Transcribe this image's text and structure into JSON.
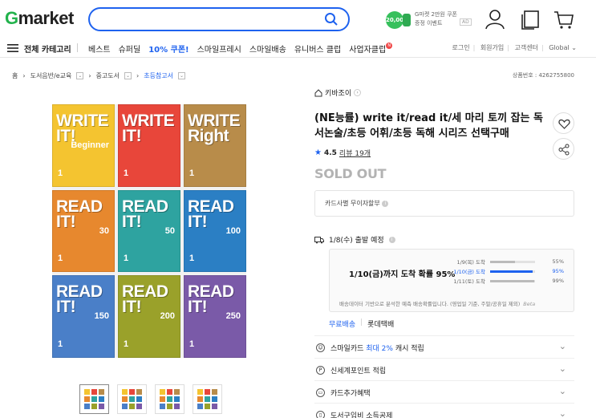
{
  "header": {
    "logo": "Gmarket",
    "logo_first": "G",
    "logo_rest": "market",
    "search_placeholder": "",
    "promo_amount": "20,000",
    "promo_line1": "G마켓 2만원 쿠폰",
    "promo_line2": "증정 이벤트",
    "promo_ad": "AD"
  },
  "nav": {
    "all_categories": "전체 카테고리",
    "links": [
      "베스트",
      "슈퍼딜",
      "10% 쿠폰!",
      "스마일프레시",
      "스마일배송",
      "유니버스 클럽",
      "사업자클럽"
    ],
    "badge": "N",
    "util": [
      "로그인",
      "회원가입",
      "고객센터",
      "Global"
    ]
  },
  "breadcrumb": {
    "home": "홈",
    "items": [
      "도서음반/e교육",
      "중고도서",
      "초등참고서"
    ],
    "product_no": "상품번호 : 4262755800"
  },
  "books": [
    {
      "title": "WRITE IT!",
      "sub": "Beginner",
      "num": "1",
      "color": "#f4c430"
    },
    {
      "title": "WRITE IT!",
      "sub": "",
      "num": "1",
      "color": "#e8463a"
    },
    {
      "title": "WRITE Right",
      "sub": "",
      "num": "1",
      "color": "#b88c4a"
    },
    {
      "title": "READ IT!",
      "sub": "30",
      "num": "1",
      "color": "#e7882e"
    },
    {
      "title": "READ IT!",
      "sub": "50",
      "num": "1",
      "color": "#2ea3a0"
    },
    {
      "title": "READ IT!",
      "sub": "100",
      "num": "1",
      "color": "#2b7fc4"
    },
    {
      "title": "READ IT!",
      "sub": "150",
      "num": "1",
      "color": "#4a7fc8"
    },
    {
      "title": "READ IT!",
      "sub": "200",
      "num": "1",
      "color": "#9aa12a"
    },
    {
      "title": "READ IT!",
      "sub": "250",
      "num": "1",
      "color": "#7a5aa8"
    }
  ],
  "product": {
    "seller": "키바조이",
    "title": "(NE능률) write it/read it/세 마리 토끼 잡는 독서논술/초등 어휘/초등 독해 시리즈 선택구매",
    "rating": "4.5",
    "review_label": "리뷰 19개",
    "status": "SOLD OUT",
    "installment": "카드사별 무이자할부"
  },
  "shipping": {
    "depart": "1/8(수) 출발 예정",
    "arrival_headline": "1/10(금)까지 도착 확률 95%",
    "rows": [
      {
        "date": "1/9(목) 도착",
        "pct": "55%",
        "value": 55,
        "highlight": false
      },
      {
        "date": "1/10(금) 도착",
        "pct": "95%",
        "value": 95,
        "highlight": true
      },
      {
        "date": "1/11(토) 도착",
        "pct": "99%",
        "value": 99,
        "highlight": false
      }
    ],
    "note": "배송데이터 기반으로 분석한 예측 배송확률입니다. (영업일 기준, 주말/공휴일 제외)",
    "beta": "Beta",
    "free": "무료배송",
    "carrier": "롯데택배"
  },
  "benefits": [
    {
      "pre": "스마일카드 ",
      "hl": "최대 2%",
      "post": " 캐시 적립",
      "icon": "smile-card-icon"
    },
    {
      "pre": "신세계포인트 적립",
      "hl": "",
      "post": "",
      "icon": "point-icon"
    },
    {
      "pre": "카드추가혜택",
      "hl": "",
      "post": "",
      "icon": "card-icon"
    },
    {
      "pre": "도서구입비 소득공제",
      "hl": "",
      "post": "",
      "icon": "book-icon"
    }
  ]
}
